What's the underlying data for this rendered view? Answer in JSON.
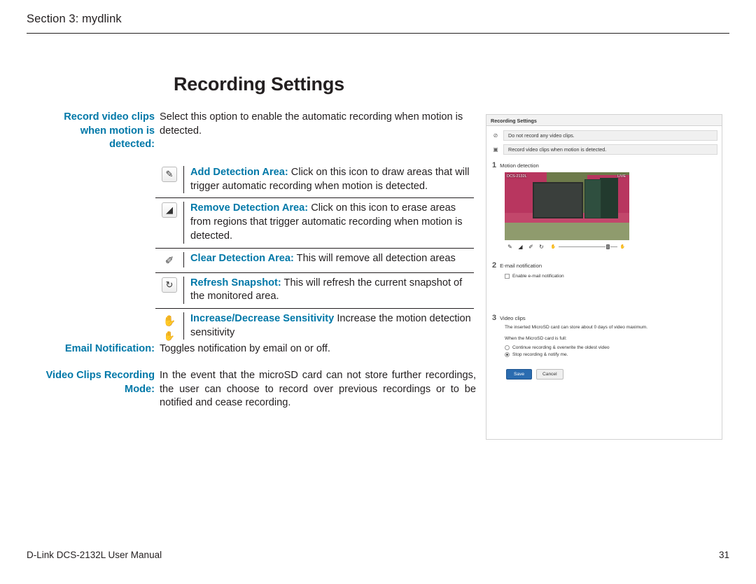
{
  "header": {
    "section": "Section 3: mydlink"
  },
  "footer": {
    "manual": "D-Link DCS-2132L User Manual",
    "page": "31"
  },
  "title": "Recording Settings",
  "rows": [
    {
      "label": "Record video clips when motion is detected:",
      "body": "Select this option to enable the automatic recording when motion is detected."
    },
    {
      "label": "Email Notification:",
      "body": "Toggles notification by email on or off."
    },
    {
      "label": "Video Clips Recording Mode:",
      "body": "In the event that the microSD card can not store further recordings, the user can choose to record over previous recordings or to be notified and cease recording."
    }
  ],
  "icon_table": [
    {
      "icon": "pencil-icon",
      "glyph": "✎",
      "term": "Add Detection Area:",
      "text": " Click on this icon to draw areas that will trigger automatic recording when motion is detected."
    },
    {
      "icon": "eraser-icon",
      "glyph": "◢",
      "term": "Remove Detection Area:",
      "text": " Click on this icon to erase areas from regions that trigger automatic recording when motion is detected."
    },
    {
      "icon": "clear-area-icon",
      "glyph": "✐",
      "term": "Clear Detection Area:",
      "text": " This will remove all detection areas"
    },
    {
      "icon": "refresh-icon",
      "glyph": "↻",
      "term": "Refresh Snapshot:",
      "text": " This will refresh the current snapshot of the monitored area."
    },
    {
      "icon": "hand-sensitivity-icon",
      "glyph": "✋",
      "glyph2": "✋",
      "term": "Increase/Decrease Sensitivity",
      "text": " Increase the motion detection sensitivity"
    }
  ],
  "screenshot": {
    "window_title": "Recording Settings",
    "options": [
      {
        "icon": "no-record-icon",
        "glyph": "⊘",
        "label": "Do not record any video clips."
      },
      {
        "icon": "record-motion-icon",
        "glyph": "▣",
        "label": "Record video clips when motion is detected."
      }
    ],
    "sections": [
      {
        "num": "1",
        "label": "Motion detection"
      },
      {
        "num": "2",
        "label": "E-mail notification"
      },
      {
        "num": "3",
        "label": "Video clips"
      }
    ],
    "preview": {
      "osd_left": "DCS-2132L",
      "osd_right": "LIVE"
    },
    "preview_tools": [
      {
        "icon": "pencil-icon",
        "glyph": "✎"
      },
      {
        "icon": "eraser-icon",
        "glyph": "◢"
      },
      {
        "icon": "clear-area-icon",
        "glyph": "✐"
      },
      {
        "icon": "refresh-icon",
        "glyph": "↻"
      }
    ],
    "slider": {
      "left_icon": "hand-low-icon",
      "left_glyph": "✋",
      "right_icon": "hand-high-icon",
      "right_glyph": "✋"
    },
    "email_checkbox": {
      "label": "Enable e-mail notification",
      "checked": false
    },
    "video_clips": {
      "note1": "The inserted MicroSD card can store about 0 days of video maximum.",
      "note2": "When the MicroSD card is full:",
      "radio1": {
        "label": "Continue recording & overwrite the oldest video",
        "selected": false
      },
      "radio2": {
        "label": "Stop recording & notify me.",
        "selected": true
      }
    },
    "buttons": {
      "save": "Save",
      "cancel": "Cancel"
    }
  },
  "colors": {
    "accent": "#0078a8",
    "text": "#231f20"
  }
}
